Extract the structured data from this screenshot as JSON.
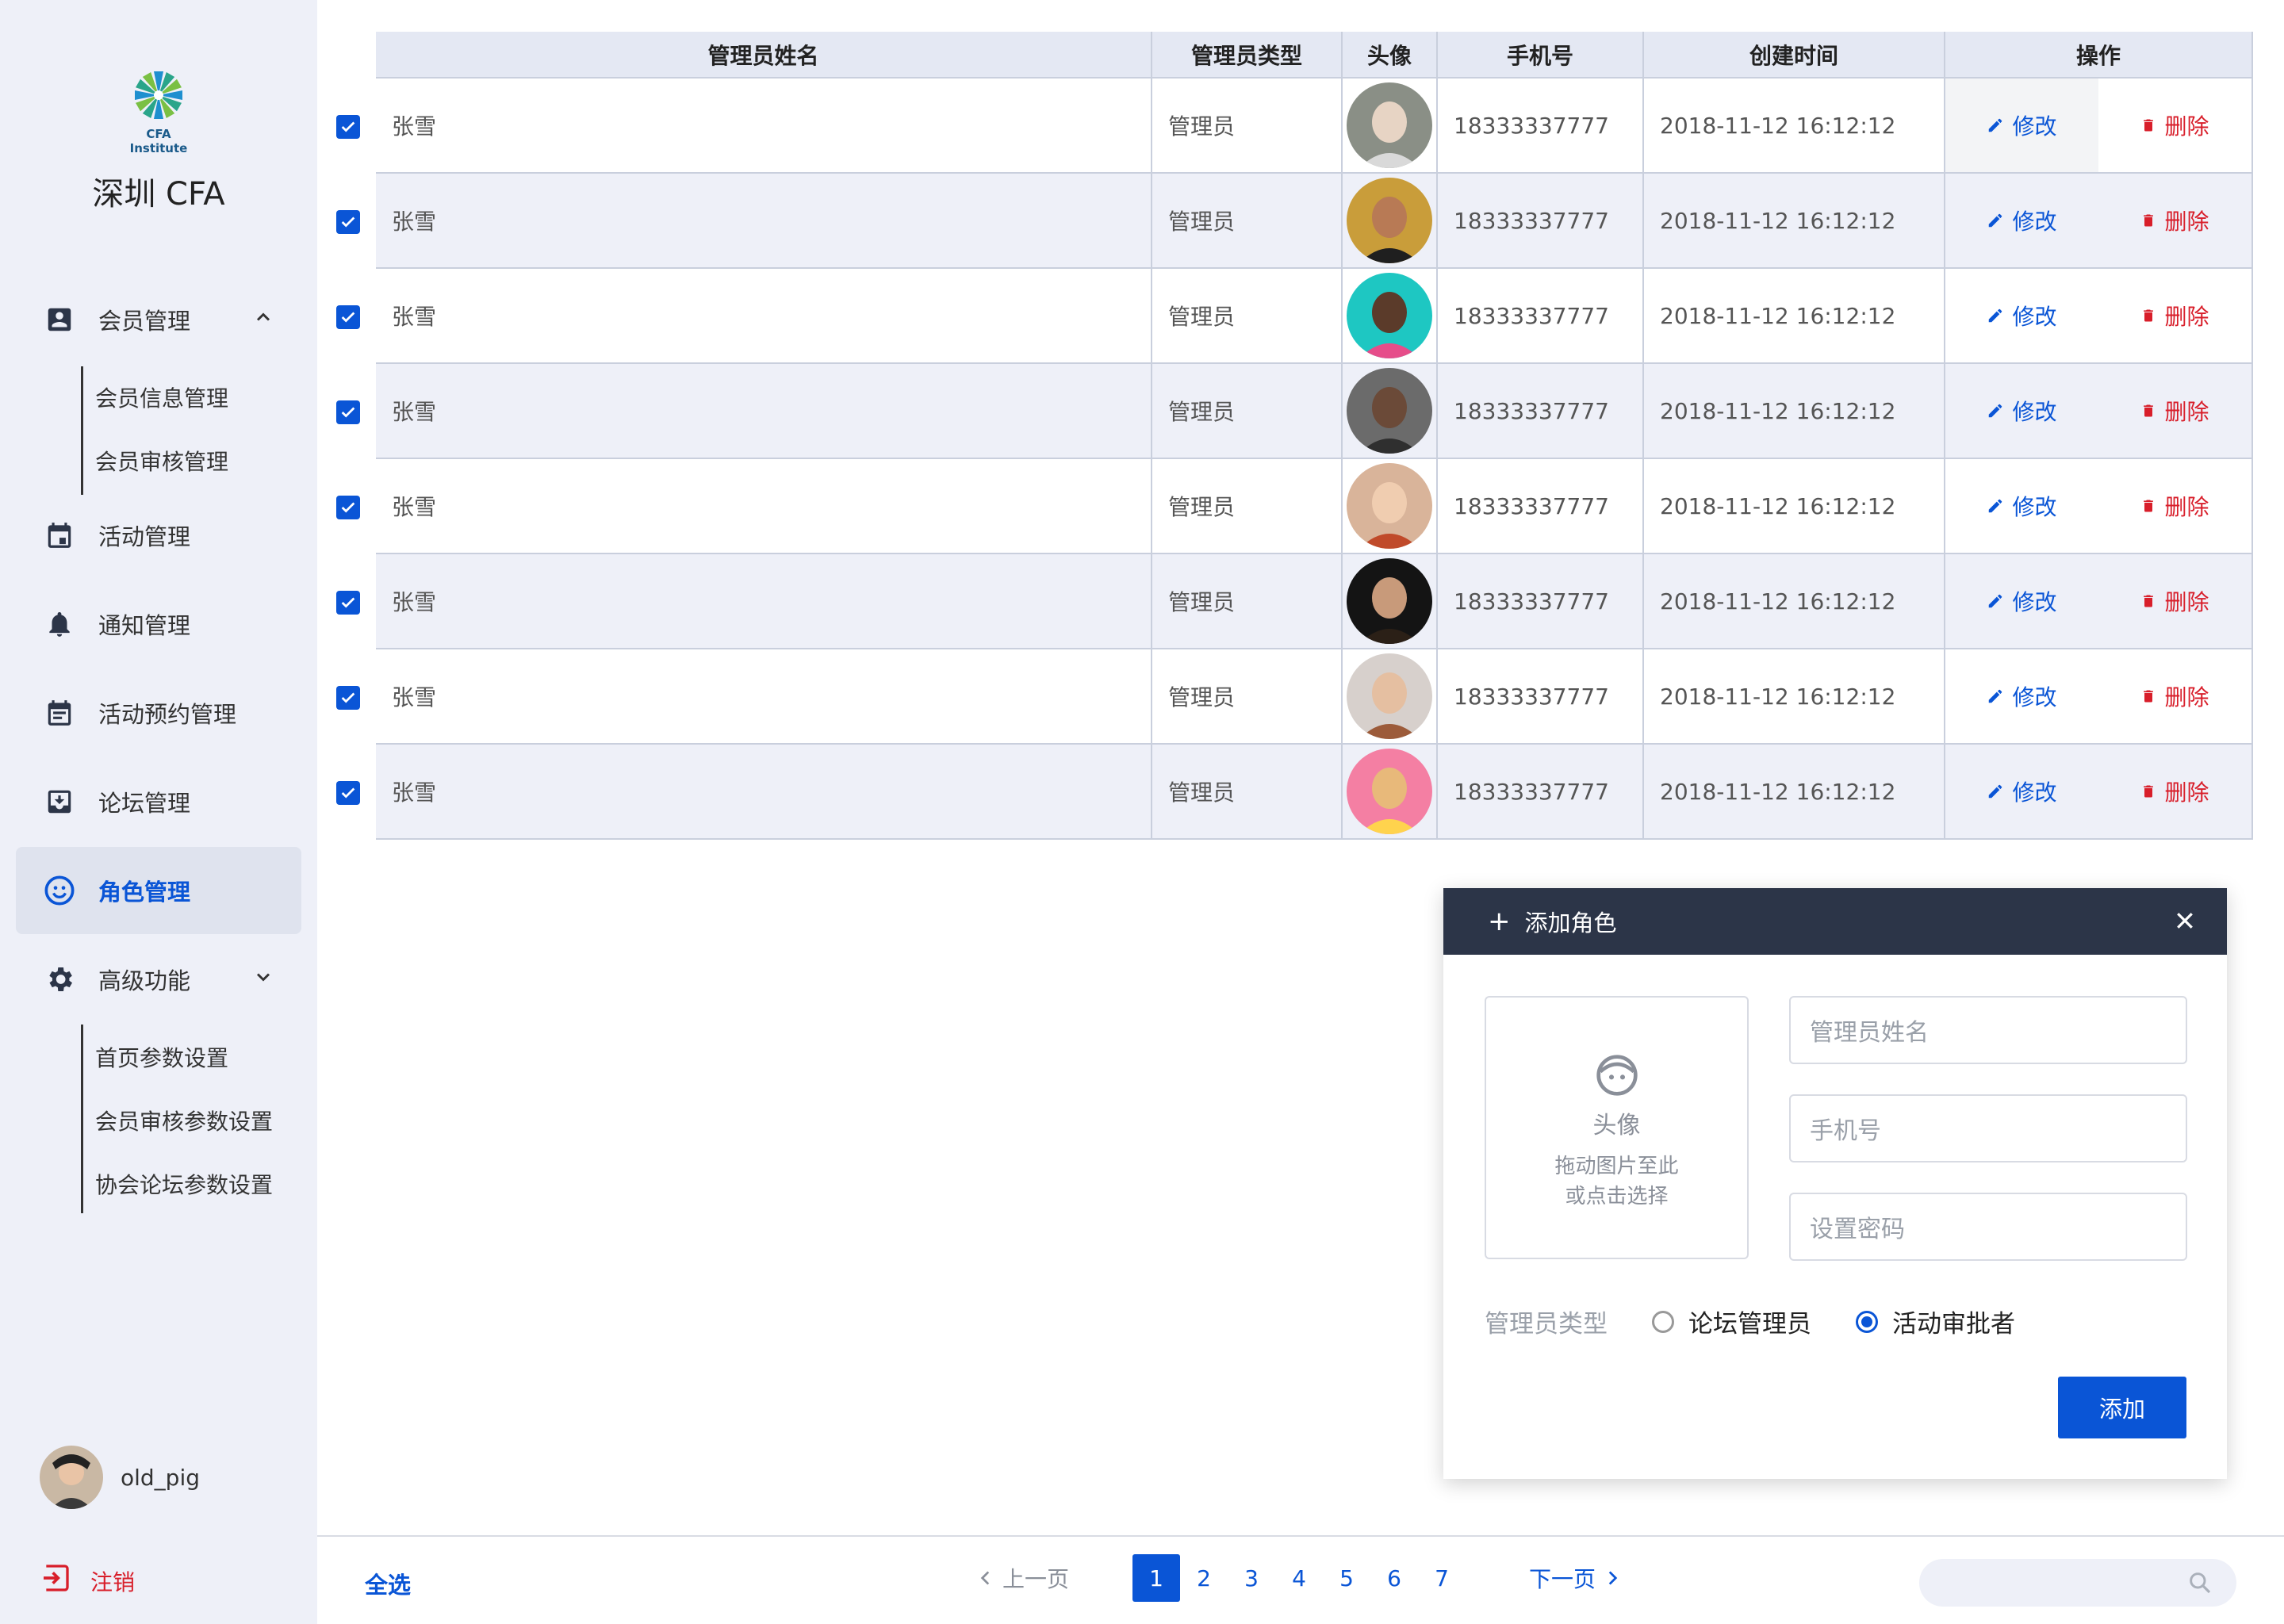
{
  "app": {
    "logo_text": "CFA Institute",
    "brand": "深圳 CFA"
  },
  "sidebar": {
    "items": [
      {
        "label": "会员管理",
        "icon": "account-box-icon",
        "expanded": true
      },
      {
        "label": "活动管理",
        "icon": "calendar-icon"
      },
      {
        "label": "通知管理",
        "icon": "bell-icon"
      },
      {
        "label": "活动预约管理",
        "icon": "calendar-note-icon"
      },
      {
        "label": "论坛管理",
        "icon": "inbox-download-icon"
      },
      {
        "label": "角色管理",
        "icon": "smiley-icon",
        "active": true
      },
      {
        "label": "高级功能",
        "icon": "gear-icon",
        "expanded": true
      }
    ],
    "member_sub": [
      "会员信息管理",
      "会员审核管理"
    ],
    "advanced_sub": [
      "首页参数设置",
      "会员审核参数设置",
      "协会论坛参数设置"
    ],
    "user": {
      "name": "old_pig"
    },
    "logout": "注销"
  },
  "table": {
    "headers": [
      "管理员姓名",
      "管理员类型",
      "头像",
      "手机号",
      "创建时间",
      "操作"
    ],
    "edit_label": "修改",
    "delete_label": "删除",
    "rows": [
      {
        "name": "张雪",
        "type": "管理员",
        "phone": "18333337777",
        "created": "2018-11-12 16:12:12",
        "checked": true
      },
      {
        "name": "张雪",
        "type": "管理员",
        "phone": "18333337777",
        "created": "2018-11-12 16:12:12",
        "checked": true
      },
      {
        "name": "张雪",
        "type": "管理员",
        "phone": "18333337777",
        "created": "2018-11-12 16:12:12",
        "checked": true
      },
      {
        "name": "张雪",
        "type": "管理员",
        "phone": "18333337777",
        "created": "2018-11-12 16:12:12",
        "checked": true
      },
      {
        "name": "张雪",
        "type": "管理员",
        "phone": "18333337777",
        "created": "2018-11-12 16:12:12",
        "checked": true
      },
      {
        "name": "张雪",
        "type": "管理员",
        "phone": "18333337777",
        "created": "2018-11-12 16:12:12",
        "checked": true
      },
      {
        "name": "张雪",
        "type": "管理员",
        "phone": "18333337777",
        "created": "2018-11-12 16:12:12",
        "checked": true
      },
      {
        "name": "张雪",
        "type": "管理员",
        "phone": "18333337777",
        "created": "2018-11-12 16:12:12",
        "checked": true
      }
    ]
  },
  "dialog": {
    "title": "添加角色",
    "upload_title": "头像",
    "upload_hint_1": "拖动图片至此",
    "upload_hint_2": "或点击选择",
    "name_placeholder": "管理员姓名",
    "phone_placeholder": "手机号",
    "password_placeholder": "设置密码",
    "type_label": "管理员类型",
    "options": [
      {
        "label": "论坛管理员",
        "selected": false
      },
      {
        "label": "活动审批者",
        "selected": true
      }
    ],
    "submit": "添加"
  },
  "footer": {
    "select_all": "全选",
    "prev": "上一页",
    "next": "下一页",
    "pages": [
      "1",
      "2",
      "3",
      "4",
      "5",
      "6",
      "7"
    ],
    "current_page": "1"
  },
  "colors": {
    "accent": "#0a55d6",
    "danger": "#d81e2a",
    "sidebar_bg": "#eef0f8",
    "header_dark": "#2c3548"
  }
}
